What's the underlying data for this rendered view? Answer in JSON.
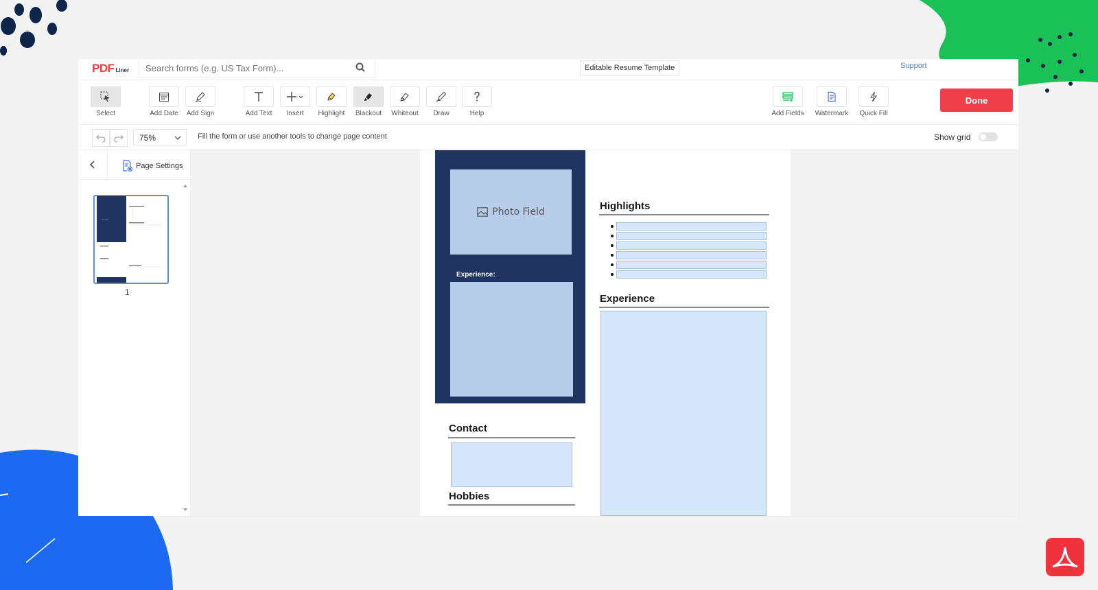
{
  "topbar": {
    "logo_main": "PDF",
    "logo_sub": "Liner",
    "search_placeholder": "Search forms (e.g. US Tax Form)...",
    "document_title": "Editable Resume Template",
    "support_label": "Support"
  },
  "toolbar": {
    "left_tools": [
      {
        "label": "Select",
        "icon": "select-cursor-icon"
      },
      {
        "label": "Add Date",
        "icon": "calendar-icon"
      },
      {
        "label": "Add Sign",
        "icon": "pen-sign-icon"
      },
      {
        "label": "Add Text",
        "icon": "text-t-icon"
      },
      {
        "label": "Insert",
        "icon": "plus-icon"
      },
      {
        "label": "Highlight",
        "icon": "highlighter-icon"
      },
      {
        "label": "Blackout",
        "icon": "blackout-brush-icon"
      },
      {
        "label": "Whiteout",
        "icon": "whiteout-brush-icon"
      },
      {
        "label": "Draw",
        "icon": "pencil-draw-icon"
      },
      {
        "label": "Help",
        "icon": "question-icon"
      }
    ],
    "right_tools": [
      {
        "label": "Add Fields",
        "icon": "add-fields-icon"
      },
      {
        "label": "Watermark",
        "icon": "watermark-icon"
      },
      {
        "label": "Quick Fill",
        "icon": "lightning-icon"
      }
    ],
    "done_label": "Done"
  },
  "subbar": {
    "zoom": "75%",
    "hint": "Fill the form or use another tools to change page content",
    "show_grid_label": "Show grid"
  },
  "sidebar": {
    "page_settings_label": "Page Settings",
    "page_number": "1"
  },
  "document": {
    "photo_field_label": "Photo Field",
    "left_experience_label": "Experience:",
    "highlights_title": "Highlights",
    "experience_title": "Experience",
    "contact_title": "Contact",
    "hobbies_title": "Hobbies"
  },
  "colors": {
    "brand_red": "#ee3f4b",
    "navy_panel": "#1f3461",
    "field_fill": "#d6e6fb",
    "photo_fill": "#b8cdea",
    "deco_green": "#19c156",
    "deco_blue": "#1d6af2"
  }
}
